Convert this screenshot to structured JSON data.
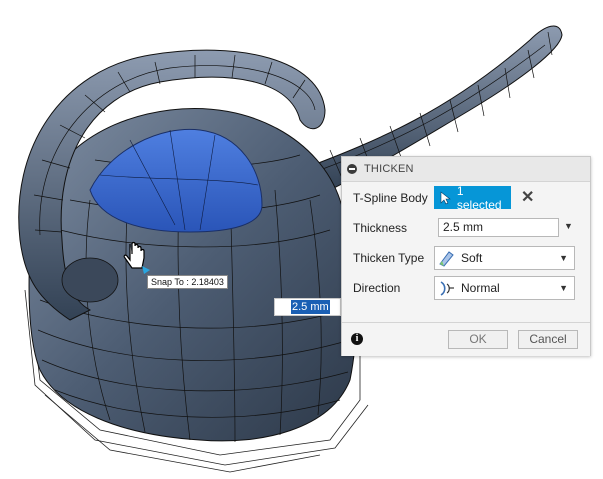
{
  "dialog": {
    "title": "THICKEN",
    "rows": {
      "body": {
        "label": "T-Spline Body",
        "selection": "1 selected"
      },
      "thickness": {
        "label": "Thickness",
        "value": "2.5 mm"
      },
      "thicken_type": {
        "label": "Thicken Type",
        "value": "Soft"
      },
      "direction": {
        "label": "Direction",
        "value": "Normal"
      }
    },
    "buttons": {
      "ok": "OK",
      "cancel": "Cancel"
    }
  },
  "canvas_input": {
    "value": "2.5 mm"
  },
  "snap_tooltip": {
    "text": "Snap To : 2.18403"
  },
  "colors": {
    "accent": "#0696d7",
    "model_body": "#4a5a6e",
    "selected_face": "#3564c8",
    "wireframe": "#111111"
  }
}
